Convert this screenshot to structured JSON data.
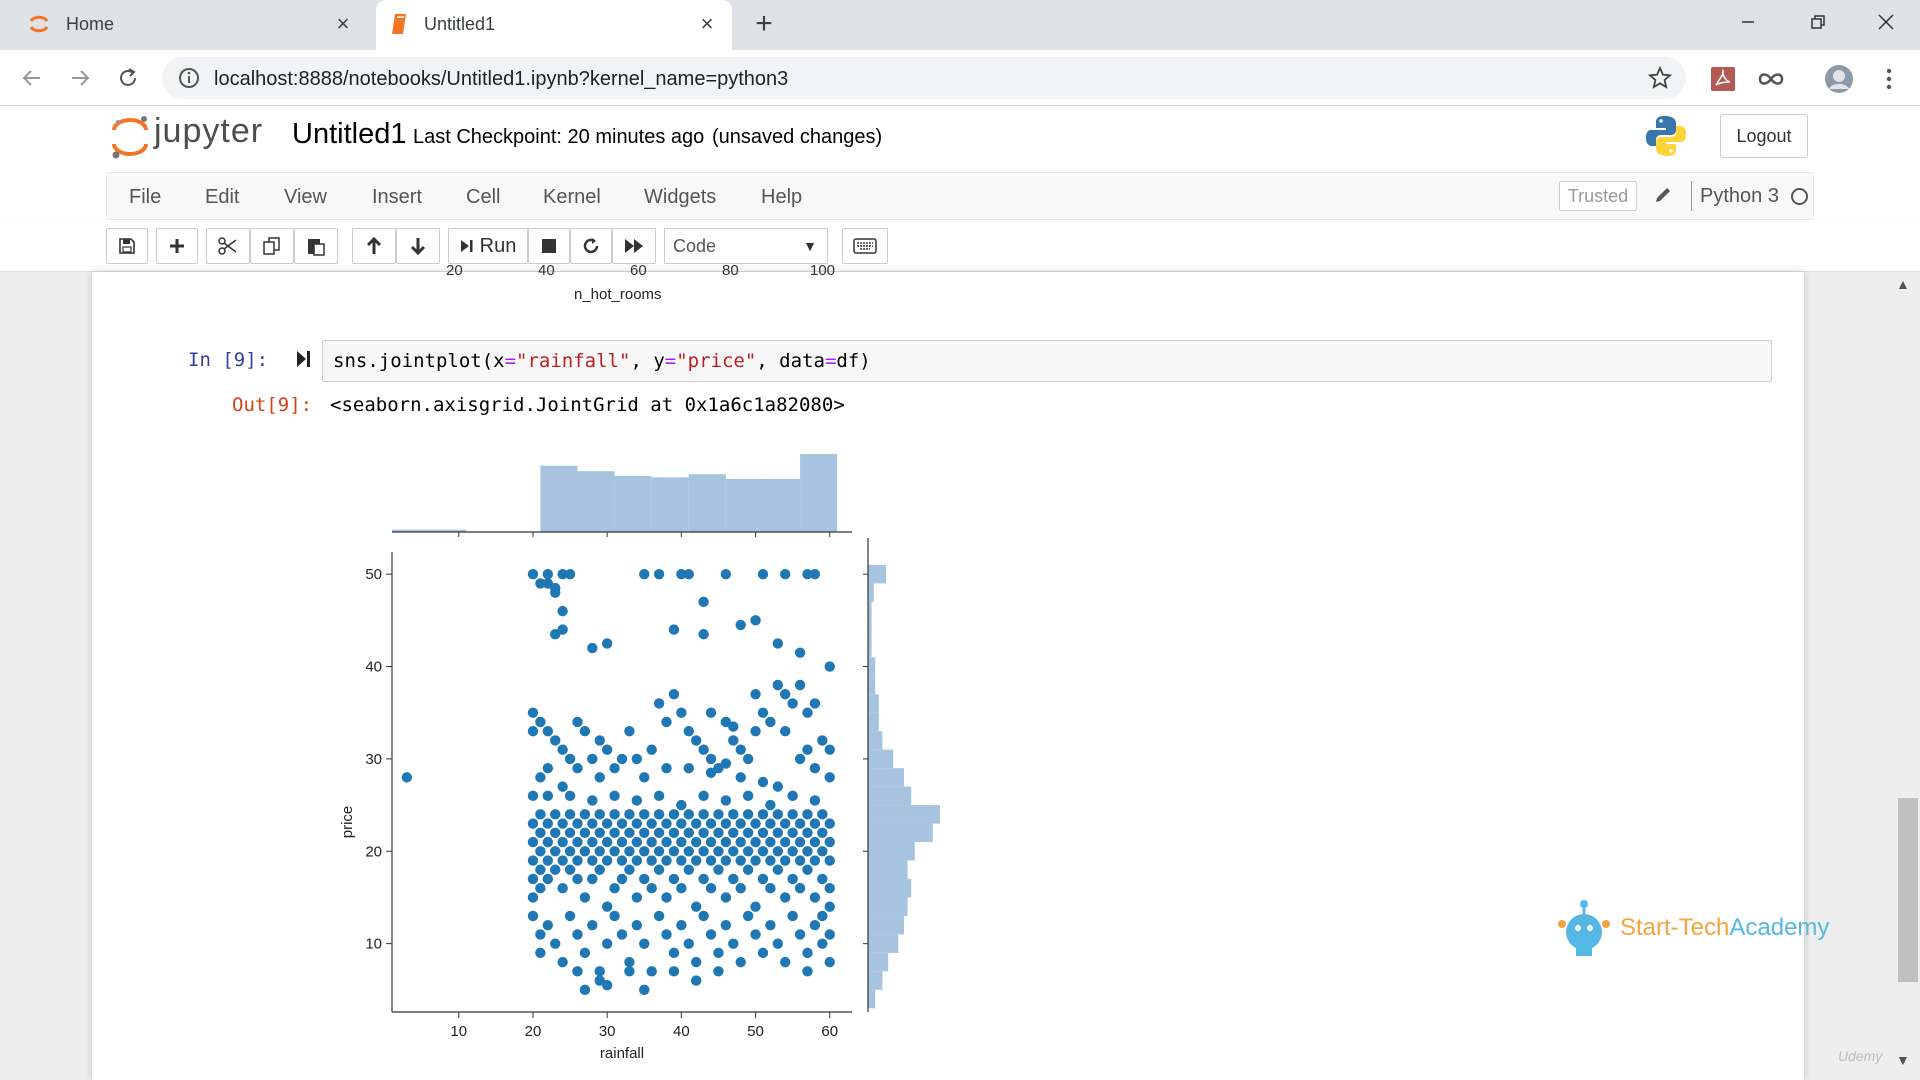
{
  "browser": {
    "tabs": [
      {
        "title": "Home",
        "icon": "jupyter-spinner-icon",
        "active": false
      },
      {
        "title": "Untitled1",
        "icon": "notebook-icon",
        "active": true
      }
    ],
    "url": "localhost:8888/notebooks/Untitled1.ipynb?kernel_name=python3"
  },
  "header": {
    "logo_text": "jupyter",
    "notebook_name": "Untitled1",
    "checkpoint": "Last Checkpoint: 20 minutes ago",
    "unsaved": "(unsaved changes)",
    "logout_label": "Logout"
  },
  "menubar": {
    "items": [
      "File",
      "Edit",
      "View",
      "Insert",
      "Cell",
      "Kernel",
      "Widgets",
      "Help"
    ],
    "trusted_label": "Trusted",
    "kernel_name": "Python 3"
  },
  "toolbar": {
    "run_label": "Run",
    "cell_type": "Code"
  },
  "notebook": {
    "previous_output": {
      "ticks": [
        "20",
        "40",
        "60",
        "80",
        "100"
      ],
      "xlabel": "n_hot_rooms"
    },
    "cell": {
      "in_prompt": "In [9]:",
      "out_prompt": "Out[9]:",
      "output_text": "<seaborn.axisgrid.JointGrid at 0x1a6c1a82080>"
    }
  },
  "chart_data": {
    "type": "scatter",
    "xlabel": "rainfall",
    "ylabel": "price",
    "xlim": [
      1,
      63
    ],
    "ylim": [
      2.6,
      52.4
    ],
    "xticks": [
      10,
      20,
      30,
      40,
      50,
      60
    ],
    "yticks": [
      10,
      20,
      30,
      40,
      50
    ],
    "point_color": "#1f77b4",
    "hist_color": "#a6c4df",
    "points": [
      [
        3,
        28
      ],
      [
        20,
        50
      ],
      [
        21,
        49
      ],
      [
        22,
        50
      ],
      [
        23,
        48
      ],
      [
        24,
        50
      ],
      [
        25,
        50
      ],
      [
        22,
        49
      ],
      [
        23,
        48.5
      ],
      [
        24,
        46
      ],
      [
        23,
        43.5
      ],
      [
        24,
        44
      ],
      [
        28,
        42
      ],
      [
        30,
        42.5
      ],
      [
        35,
        50
      ],
      [
        37,
        50
      ],
      [
        40,
        50
      ],
      [
        41,
        50
      ],
      [
        43,
        47
      ],
      [
        43,
        43.5
      ],
      [
        46,
        50
      ],
      [
        50,
        45
      ],
      [
        51,
        50
      ],
      [
        54,
        50
      ],
      [
        57,
        50
      ],
      [
        58,
        50
      ],
      [
        48,
        44.5
      ],
      [
        39,
        44
      ],
      [
        53,
        42.5
      ],
      [
        56,
        41.5
      ],
      [
        60,
        40
      ],
      [
        20,
        35
      ],
      [
        20,
        33
      ],
      [
        21,
        34
      ],
      [
        22,
        33
      ],
      [
        23,
        32
      ],
      [
        24,
        31
      ],
      [
        25,
        30
      ],
      [
        22,
        29
      ],
      [
        26,
        34
      ],
      [
        27,
        33
      ],
      [
        28,
        30
      ],
      [
        29,
        32
      ],
      [
        30,
        31
      ],
      [
        31,
        29
      ],
      [
        33,
        33
      ],
      [
        34,
        30
      ],
      [
        36,
        31
      ],
      [
        37,
        36
      ],
      [
        38,
        34
      ],
      [
        39,
        37
      ],
      [
        40,
        35
      ],
      [
        41,
        33
      ],
      [
        42,
        32
      ],
      [
        43,
        31
      ],
      [
        44,
        30
      ],
      [
        45,
        29
      ],
      [
        46,
        34
      ],
      [
        47,
        32
      ],
      [
        48,
        31
      ],
      [
        49,
        30
      ],
      [
        50,
        33
      ],
      [
        51,
        35
      ],
      [
        52,
        34
      ],
      [
        53,
        38
      ],
      [
        54,
        37
      ],
      [
        55,
        36
      ],
      [
        56,
        38
      ],
      [
        57,
        35
      ],
      [
        58,
        36
      ],
      [
        59,
        32
      ],
      [
        60,
        31
      ],
      [
        60,
        28
      ],
      [
        58,
        29
      ],
      [
        56,
        30
      ],
      [
        53,
        27
      ],
      [
        51,
        27.5
      ],
      [
        48,
        28
      ],
      [
        46,
        29.5
      ],
      [
        44,
        28.5
      ],
      [
        41,
        29
      ],
      [
        38,
        29
      ],
      [
        35,
        28
      ],
      [
        32,
        30
      ],
      [
        29,
        28
      ],
      [
        26,
        29
      ],
      [
        24,
        27
      ],
      [
        21,
        28
      ],
      [
        54,
        33
      ],
      [
        57,
        31
      ],
      [
        47,
        33.5
      ],
      [
        44,
        35
      ],
      [
        50,
        37
      ],
      [
        20,
        23
      ],
      [
        20,
        21
      ],
      [
        20,
        19
      ],
      [
        20,
        17
      ],
      [
        20,
        15
      ],
      [
        21,
        24
      ],
      [
        21,
        22
      ],
      [
        21,
        20
      ],
      [
        21,
        18
      ],
      [
        21,
        16
      ],
      [
        22,
        23
      ],
      [
        22,
        21
      ],
      [
        22,
        19
      ],
      [
        22,
        17
      ],
      [
        23,
        24
      ],
      [
        23,
        22
      ],
      [
        23,
        20
      ],
      [
        23,
        18
      ],
      [
        24,
        23
      ],
      [
        24,
        21
      ],
      [
        24,
        19
      ],
      [
        24,
        16
      ],
      [
        25,
        24
      ],
      [
        25,
        22
      ],
      [
        25,
        20
      ],
      [
        25,
        18
      ],
      [
        26,
        23
      ],
      [
        26,
        21
      ],
      [
        26,
        19
      ],
      [
        26,
        17
      ],
      [
        27,
        24
      ],
      [
        27,
        22
      ],
      [
        27,
        20
      ],
      [
        27,
        15
      ],
      [
        28,
        23
      ],
      [
        28,
        21
      ],
      [
        28,
        19
      ],
      [
        28,
        17
      ],
      [
        29,
        24
      ],
      [
        29,
        22
      ],
      [
        29,
        20
      ],
      [
        29,
        18
      ],
      [
        30,
        23
      ],
      [
        30,
        21
      ],
      [
        30,
        19
      ],
      [
        30,
        14
      ],
      [
        31,
        24
      ],
      [
        31,
        22
      ],
      [
        31,
        20
      ],
      [
        31,
        16
      ],
      [
        32,
        23
      ],
      [
        32,
        21
      ],
      [
        32,
        19
      ],
      [
        32,
        17
      ],
      [
        33,
        24
      ],
      [
        33,
        22
      ],
      [
        33,
        20
      ],
      [
        33,
        18
      ],
      [
        34,
        23
      ],
      [
        34,
        21
      ],
      [
        34,
        19
      ],
      [
        34,
        15
      ],
      [
        35,
        24
      ],
      [
        35,
        22
      ],
      [
        35,
        20
      ],
      [
        35,
        17
      ],
      [
        36,
        23
      ],
      [
        36,
        21
      ],
      [
        36,
        19
      ],
      [
        36,
        16
      ],
      [
        37,
        24
      ],
      [
        37,
        22
      ],
      [
        37,
        20
      ],
      [
        37,
        18
      ],
      [
        38,
        23
      ],
      [
        38,
        21
      ],
      [
        38,
        19
      ],
      [
        38,
        15
      ],
      [
        39,
        24
      ],
      [
        39,
        22
      ],
      [
        39,
        20
      ],
      [
        39,
        17
      ],
      [
        40,
        23
      ],
      [
        40,
        21
      ],
      [
        40,
        19
      ],
      [
        40,
        16
      ],
      [
        41,
        24
      ],
      [
        41,
        22
      ],
      [
        41,
        20
      ],
      [
        41,
        18
      ],
      [
        42,
        23
      ],
      [
        42,
        21
      ],
      [
        42,
        19
      ],
      [
        42,
        14
      ],
      [
        43,
        24
      ],
      [
        43,
        22
      ],
      [
        43,
        20
      ],
      [
        43,
        17
      ],
      [
        44,
        23
      ],
      [
        44,
        21
      ],
      [
        44,
        19
      ],
      [
        44,
        16
      ],
      [
        45,
        24
      ],
      [
        45,
        22
      ],
      [
        45,
        20
      ],
      [
        45,
        18
      ],
      [
        46,
        23
      ],
      [
        46,
        21
      ],
      [
        46,
        19
      ],
      [
        46,
        15
      ],
      [
        47,
        24
      ],
      [
        47,
        22
      ],
      [
        47,
        20
      ],
      [
        47,
        17
      ],
      [
        48,
        23
      ],
      [
        48,
        21
      ],
      [
        48,
        19
      ],
      [
        48,
        16
      ],
      [
        49,
        24
      ],
      [
        49,
        22
      ],
      [
        49,
        20
      ],
      [
        49,
        18
      ],
      [
        50,
        23
      ],
      [
        50,
        21
      ],
      [
        50,
        19
      ],
      [
        50,
        14
      ],
      [
        51,
        24
      ],
      [
        51,
        22
      ],
      [
        51,
        20
      ],
      [
        51,
        17
      ],
      [
        52,
        23
      ],
      [
        52,
        21
      ],
      [
        52,
        19
      ],
      [
        52,
        16
      ],
      [
        53,
        24
      ],
      [
        53,
        22
      ],
      [
        53,
        20
      ],
      [
        53,
        18
      ],
      [
        54,
        23
      ],
      [
        54,
        21
      ],
      [
        54,
        19
      ],
      [
        54,
        15
      ],
      [
        55,
        24
      ],
      [
        55,
        22
      ],
      [
        55,
        20
      ],
      [
        55,
        17
      ],
      [
        56,
        23
      ],
      [
        56,
        21
      ],
      [
        56,
        19
      ],
      [
        56,
        16
      ],
      [
        57,
        24
      ],
      [
        57,
        22
      ],
      [
        57,
        20
      ],
      [
        57,
        18
      ],
      [
        58,
        23
      ],
      [
        58,
        21
      ],
      [
        58,
        19
      ],
      [
        58,
        15
      ],
      [
        59,
        24
      ],
      [
        59,
        22
      ],
      [
        59,
        20
      ],
      [
        59,
        17
      ],
      [
        60,
        23
      ],
      [
        60,
        21
      ],
      [
        60,
        19
      ],
      [
        60,
        16
      ],
      [
        20,
        26
      ],
      [
        22,
        26
      ],
      [
        25,
        26
      ],
      [
        28,
        25.5
      ],
      [
        31,
        26
      ],
      [
        34,
        25.5
      ],
      [
        37,
        26
      ],
      [
        40,
        25
      ],
      [
        43,
        26
      ],
      [
        46,
        25.5
      ],
      [
        49,
        26
      ],
      [
        52,
        25
      ],
      [
        55,
        26
      ],
      [
        58,
        25.5
      ],
      [
        20,
        13
      ],
      [
        21,
        11
      ],
      [
        21,
        9
      ],
      [
        22,
        12
      ],
      [
        23,
        10
      ],
      [
        24,
        8
      ],
      [
        25,
        13
      ],
      [
        26,
        11
      ],
      [
        27,
        9
      ],
      [
        28,
        12
      ],
      [
        29,
        7
      ],
      [
        30,
        10
      ],
      [
        31,
        13
      ],
      [
        32,
        11
      ],
      [
        33,
        8
      ],
      [
        34,
        12
      ],
      [
        35,
        10
      ],
      [
        36,
        7
      ],
      [
        37,
        13
      ],
      [
        38,
        11
      ],
      [
        39,
        9
      ],
      [
        40,
        12
      ],
      [
        41,
        10
      ],
      [
        42,
        8
      ],
      [
        43,
        13
      ],
      [
        44,
        11
      ],
      [
        45,
        9
      ],
      [
        46,
        12
      ],
      [
        47,
        10
      ],
      [
        48,
        8
      ],
      [
        49,
        13
      ],
      [
        50,
        11
      ],
      [
        51,
        9
      ],
      [
        52,
        12
      ],
      [
        53,
        10
      ],
      [
        54,
        8
      ],
      [
        55,
        13
      ],
      [
        56,
        11
      ],
      [
        57,
        9
      ],
      [
        58,
        12
      ],
      [
        59,
        10
      ],
      [
        60,
        8
      ],
      [
        60,
        11
      ],
      [
        60,
        14
      ],
      [
        59,
        13
      ],
      [
        57,
        7
      ],
      [
        45,
        7
      ],
      [
        42,
        6
      ],
      [
        39,
        7
      ],
      [
        35,
        5
      ],
      [
        33,
        7
      ],
      [
        30,
        5.5
      ],
      [
        27,
        5
      ],
      [
        26,
        7
      ],
      [
        29,
        6
      ]
    ],
    "x_hist": {
      "bin_edges": [
        1,
        6,
        11,
        16,
        21,
        26,
        31,
        36,
        41,
        46,
        51,
        56,
        61
      ],
      "heights": [
        0.03,
        0.03,
        0,
        0,
        0.85,
        0.78,
        0.72,
        0.7,
        0.74,
        0.68,
        0.68,
        1.0
      ]
    },
    "y_hist": {
      "bin_edges": [
        3,
        5,
        7,
        9,
        11,
        13,
        15,
        17,
        19,
        21,
        23,
        25,
        27,
        29,
        31,
        33,
        35,
        37,
        39,
        41,
        43,
        45,
        47,
        49,
        51
      ],
      "heights": [
        0.1,
        0.2,
        0.28,
        0.42,
        0.5,
        0.55,
        0.6,
        0.55,
        0.65,
        0.9,
        1.0,
        0.6,
        0.5,
        0.35,
        0.2,
        0.15,
        0.15,
        0.1,
        0.1,
        0.05,
        0.05,
        0.05,
        0.08,
        0.25
      ]
    }
  },
  "branding": {
    "name_part1": "Start-Tech",
    "name_part2": "Academy",
    "watermark": "Udemy"
  }
}
